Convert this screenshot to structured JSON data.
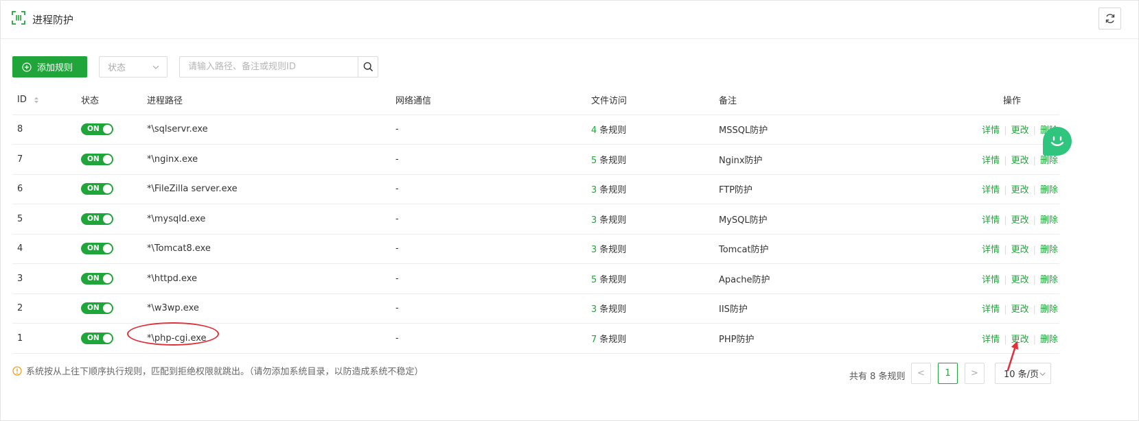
{
  "header": {
    "title": "进程防护"
  },
  "toolbar": {
    "add_label": "添加规则",
    "status_select": "状态",
    "search_placeholder": "请输入路径、备注或规则ID"
  },
  "table": {
    "columns": [
      "ID",
      "状态",
      "进程路径",
      "网络通信",
      "文件访问",
      "备注",
      "操作"
    ],
    "rows": [
      {
        "id": "8",
        "status": "ON",
        "path": "*\\sqlservr.exe",
        "network": "-",
        "file_count": "4",
        "file_unit": "条规则",
        "note": "MSSQL防护"
      },
      {
        "id": "7",
        "status": "ON",
        "path": "*\\nginx.exe",
        "network": "-",
        "file_count": "5",
        "file_unit": "条规则",
        "note": "Nginx防护"
      },
      {
        "id": "6",
        "status": "ON",
        "path": "*\\FileZilla server.exe",
        "network": "-",
        "file_count": "3",
        "file_unit": "条规则",
        "note": "FTP防护"
      },
      {
        "id": "5",
        "status": "ON",
        "path": "*\\mysqld.exe",
        "network": "-",
        "file_count": "3",
        "file_unit": "条规则",
        "note": "MySQL防护"
      },
      {
        "id": "4",
        "status": "ON",
        "path": "*\\Tomcat8.exe",
        "network": "-",
        "file_count": "3",
        "file_unit": "条规则",
        "note": "Tomcat防护"
      },
      {
        "id": "3",
        "status": "ON",
        "path": "*\\httpd.exe",
        "network": "-",
        "file_count": "5",
        "file_unit": "条规则",
        "note": "Apache防护"
      },
      {
        "id": "2",
        "status": "ON",
        "path": "*\\w3wp.exe",
        "network": "-",
        "file_count": "3",
        "file_unit": "条规则",
        "note": "IIS防护"
      },
      {
        "id": "1",
        "status": "ON",
        "path": "*\\php-cgi.exe",
        "network": "-",
        "file_count": "7",
        "file_unit": "条规则",
        "note": "PHP防护"
      }
    ],
    "ops": {
      "detail": "详情",
      "edit": "更改",
      "delete": "删除"
    }
  },
  "footer": {
    "note": "系统按从上往下顺序执行规则，匹配到拒绝权限就跳出。（请勿添加系统目录，以防造成系统不稳定）"
  },
  "pager": {
    "total": "共有 8 条规则",
    "prev": "<",
    "current_page": "1",
    "next": ">",
    "page_size": "10 条/页"
  },
  "colors": {
    "accent": "#20a53a",
    "annotation": "#e0303a",
    "chat": "#2fc57e"
  }
}
